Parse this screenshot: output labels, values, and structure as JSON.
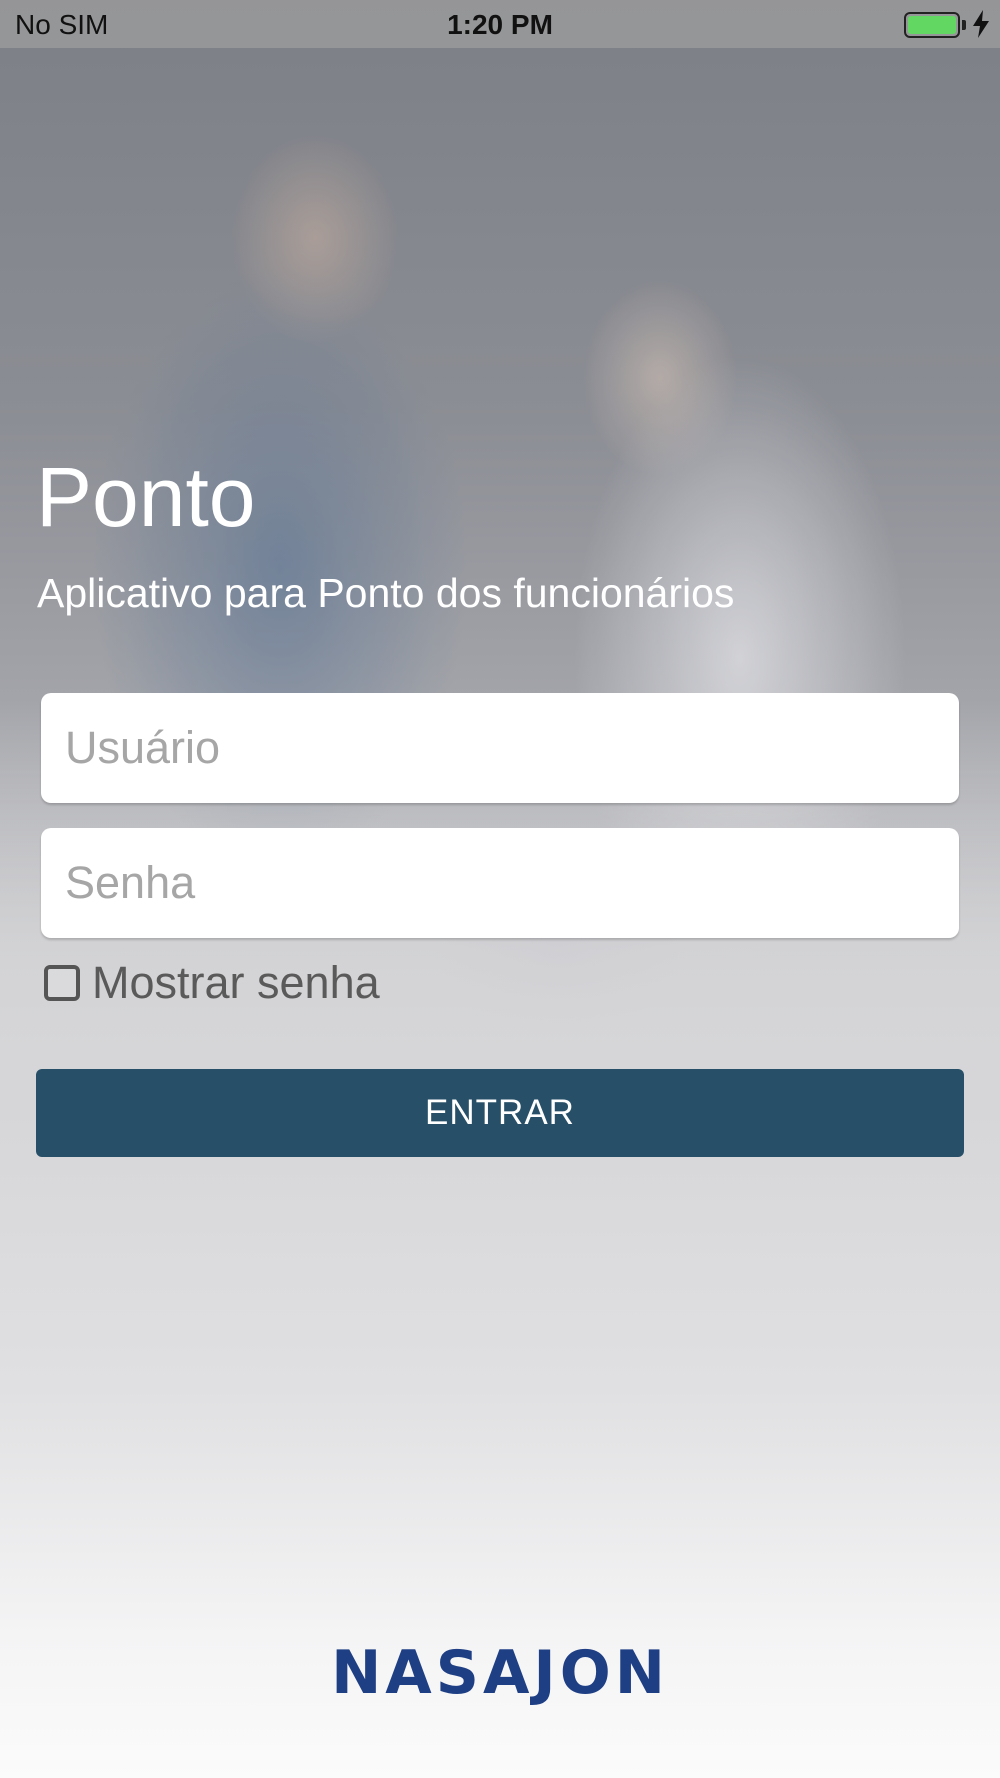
{
  "status_bar": {
    "carrier": "No SIM",
    "time": "1:20 PM",
    "battery_color": "#62d863",
    "charging_icon": "bolt-icon"
  },
  "header": {
    "title": "Ponto",
    "subtitle": "Aplicativo para Ponto dos funcionários"
  },
  "form": {
    "username_placeholder": "Usuário",
    "username_value": "",
    "password_placeholder": "Senha",
    "password_value": "",
    "show_password_label": "Mostrar senha",
    "show_password_checked": false,
    "submit_label": "ENTRAR"
  },
  "footer": {
    "logo_text": "NASAJON"
  },
  "colors": {
    "button": "#275068",
    "logo": "#1f3f85"
  }
}
